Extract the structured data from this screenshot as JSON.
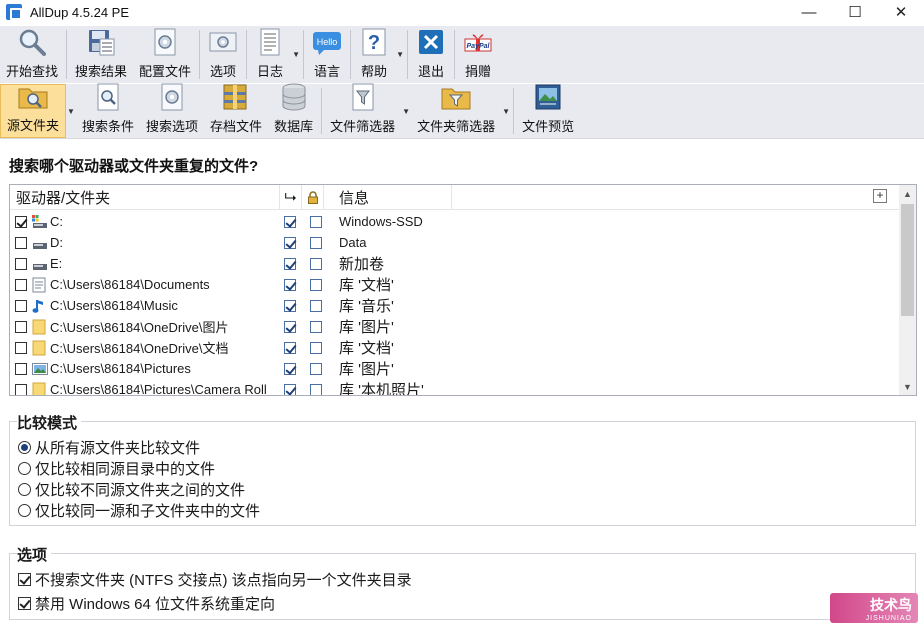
{
  "window": {
    "title": "AllDup 4.5.24 PE",
    "minimize": "—",
    "maximize": "☐",
    "close": "✕"
  },
  "toolbar_top": [
    {
      "label": "开始查找",
      "icon": "magnifier-icon"
    },
    {
      "label": "搜索结果",
      "icon": "floppy-list-icon"
    },
    {
      "label": "配置文件",
      "icon": "gear-page-icon"
    },
    {
      "label": "选项",
      "icon": "gear-panel-icon"
    },
    {
      "label": "日志",
      "icon": "log-page-icon"
    },
    {
      "label": "语言",
      "icon": "hello-icon",
      "icon_text": "Hello"
    },
    {
      "label": "帮助",
      "icon": "question-icon"
    },
    {
      "label": "退出",
      "icon": "exit-x-icon"
    },
    {
      "label": "捐赠",
      "icon": "paypal-icon",
      "icon_text": "PayPal"
    }
  ],
  "toolbar_bottom": [
    {
      "label": "源文件夹",
      "icon": "folder-search-icon",
      "active": true
    },
    {
      "label": "搜索条件",
      "icon": "search-page-icon"
    },
    {
      "label": "搜索选项",
      "icon": "gear-page-icon"
    },
    {
      "label": "存档文件",
      "icon": "archive-icon"
    },
    {
      "label": "数据库",
      "icon": "database-icon"
    },
    {
      "label": "文件筛选器",
      "icon": "file-filter-icon"
    },
    {
      "label": "文件夹筛选器",
      "icon": "folder-filter-icon"
    },
    {
      "label": "文件预览",
      "icon": "preview-icon"
    }
  ],
  "question": "搜索哪个驱动器或文件夹重复的文件?",
  "list": {
    "headers": {
      "path": "驱动器/文件夹",
      "subfolder": "⮡",
      "lock": "🔒",
      "info": "信息",
      "add": "+"
    },
    "rows": [
      {
        "checked": true,
        "icon": "system-drive-icon",
        "path": "C:",
        "sub": true,
        "lock": false,
        "info": "Windows-SSD",
        "cjk": false
      },
      {
        "checked": false,
        "icon": "drive-icon",
        "path": "D:",
        "sub": true,
        "lock": false,
        "info": "Data",
        "cjk": false
      },
      {
        "checked": false,
        "icon": "drive-icon",
        "path": "E:",
        "sub": true,
        "lock": false,
        "info": "新加卷",
        "cjk": true
      },
      {
        "checked": false,
        "icon": "document-folder-icon",
        "path": "C:\\Users\\86184\\Documents",
        "sub": true,
        "lock": false,
        "info": "库 '文档'",
        "cjk": true
      },
      {
        "checked": false,
        "icon": "music-note-icon",
        "path": "C:\\Users\\86184\\Music",
        "sub": true,
        "lock": false,
        "info": "库 '音乐'",
        "cjk": true
      },
      {
        "checked": false,
        "icon": "folder-icon",
        "path": "C:\\Users\\86184\\OneDrive\\图片",
        "sub": true,
        "lock": false,
        "info": "库 '图片'",
        "cjk": true
      },
      {
        "checked": false,
        "icon": "folder-icon",
        "path": "C:\\Users\\86184\\OneDrive\\文档",
        "sub": true,
        "lock": false,
        "info": "库 '文档'",
        "cjk": true
      },
      {
        "checked": false,
        "icon": "picture-folder-icon",
        "path": "C:\\Users\\86184\\Pictures",
        "sub": true,
        "lock": false,
        "info": "库 '图片'",
        "cjk": true
      },
      {
        "checked": false,
        "icon": "folder-icon",
        "path": "C:\\Users\\86184\\Pictures\\Camera Roll",
        "sub": true,
        "lock": false,
        "info": "库 '本机照片'",
        "cjk": true
      }
    ]
  },
  "compare_mode": {
    "title": "比较模式",
    "options": [
      {
        "label": "从所有源文件夹比较文件",
        "selected": true
      },
      {
        "label": "仅比较相同源目录中的文件",
        "selected": false
      },
      {
        "label": "仅比较不同源文件夹之间的文件",
        "selected": false
      },
      {
        "label": "仅比较同一源和子文件夹中的文件",
        "selected": false
      }
    ]
  },
  "options": {
    "title": "选项",
    "items": [
      {
        "label": "不搜索文件夹 (NTFS 交接点) 该点指向另一个文件夹目录",
        "checked": true
      },
      {
        "label": "禁用 Windows 64 位文件系统重定向",
        "checked": true
      }
    ]
  },
  "watermark": {
    "text": "技术鸟",
    "sub": "JISHUNIAO"
  },
  "colors": {
    "toolbar_bg": "#e8eaf0",
    "active_button": "#fbdf9a",
    "accent_blue": "#2b7bd6"
  }
}
